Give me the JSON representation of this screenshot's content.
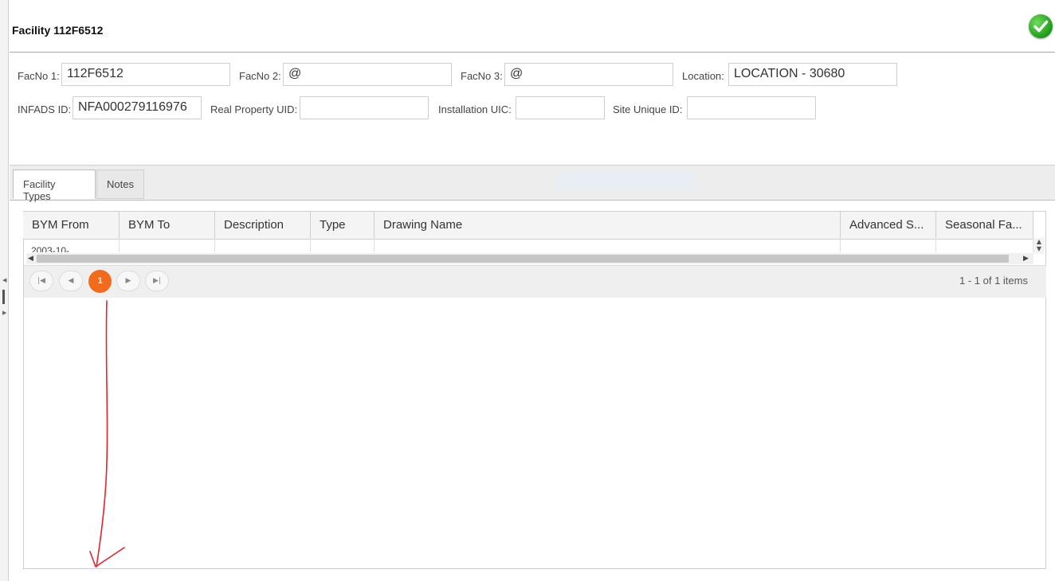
{
  "title": "Facility 112F6512",
  "status_icon": "checkmark-circle-icon",
  "accent_color": "#f26a1b",
  "success_color": "#1f9a1a",
  "fields": {
    "facno1": {
      "label": "FacNo 1:",
      "value": "112F6512"
    },
    "facno2": {
      "label": "FacNo 2:",
      "value": "@"
    },
    "facno3": {
      "label": "FacNo 3:",
      "value": "@"
    },
    "location": {
      "label": "Location:",
      "value": "LOCATION - 30680"
    },
    "infads": {
      "label": "INFADS ID:",
      "value": "NFA000279116976"
    },
    "rpuid": {
      "label": "Real Property UID:",
      "value": ""
    },
    "uic": {
      "label": "Installation UIC:",
      "value": ""
    },
    "siteid": {
      "label": "Site Unique ID:",
      "value": ""
    }
  },
  "tabs": [
    {
      "label": "Facility Types",
      "active": true
    },
    {
      "label": "Notes",
      "active": false
    }
  ],
  "grid": {
    "columns": [
      "BYM From",
      "BYM To",
      "Description",
      "Type",
      "Drawing Name",
      "Advanced S...",
      "Seasonal Fa..."
    ],
    "rows": [
      [
        "2003-10-",
        "",
        "",
        "",
        "",
        "",
        ""
      ]
    ]
  },
  "pager": {
    "current_page": "1",
    "info": "1 - 1 of 1 items"
  }
}
